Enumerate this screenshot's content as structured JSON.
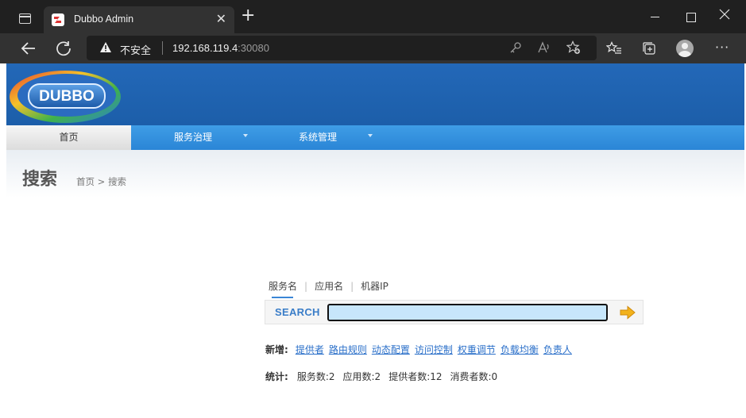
{
  "browser": {
    "tab_title": "Dubbo Admin",
    "tab_close": "✕",
    "new_tab": "+",
    "insecure_label": "不安全",
    "url_host": "192.168.119.4",
    "url_port": ":30080",
    "more": "···"
  },
  "header": {
    "logo_text": "DUBBO"
  },
  "menu": {
    "items": [
      {
        "label": "首页",
        "active": true
      },
      {
        "label": "服务治理",
        "has_dropdown": true
      },
      {
        "label": "系统管理",
        "has_dropdown": true
      }
    ]
  },
  "page": {
    "title": "搜索",
    "breadcrumb": "首页 > 搜索"
  },
  "search": {
    "tabs": [
      "服务名",
      "应用名",
      "机器IP"
    ],
    "tab_separator": "|",
    "label": "SEARCH",
    "input_value": "",
    "input_placeholder": ""
  },
  "quick_add": {
    "label": "新增:",
    "links": [
      "提供者",
      "路由规则",
      "动态配置",
      "访问控制",
      "权重调节",
      "负载均衡",
      "负责人"
    ]
  },
  "stats": {
    "label": "统计:",
    "items": [
      "服务数:2",
      "应用数:2",
      "提供者数:12",
      "消费者数:0"
    ]
  },
  "colors": {
    "header_blue": "#1c5ea9",
    "menu_blue": "#2a85d6",
    "link_blue": "#2a6fc9",
    "input_fill": "#c7e6fb",
    "go_arrow": "#f2b21c"
  }
}
